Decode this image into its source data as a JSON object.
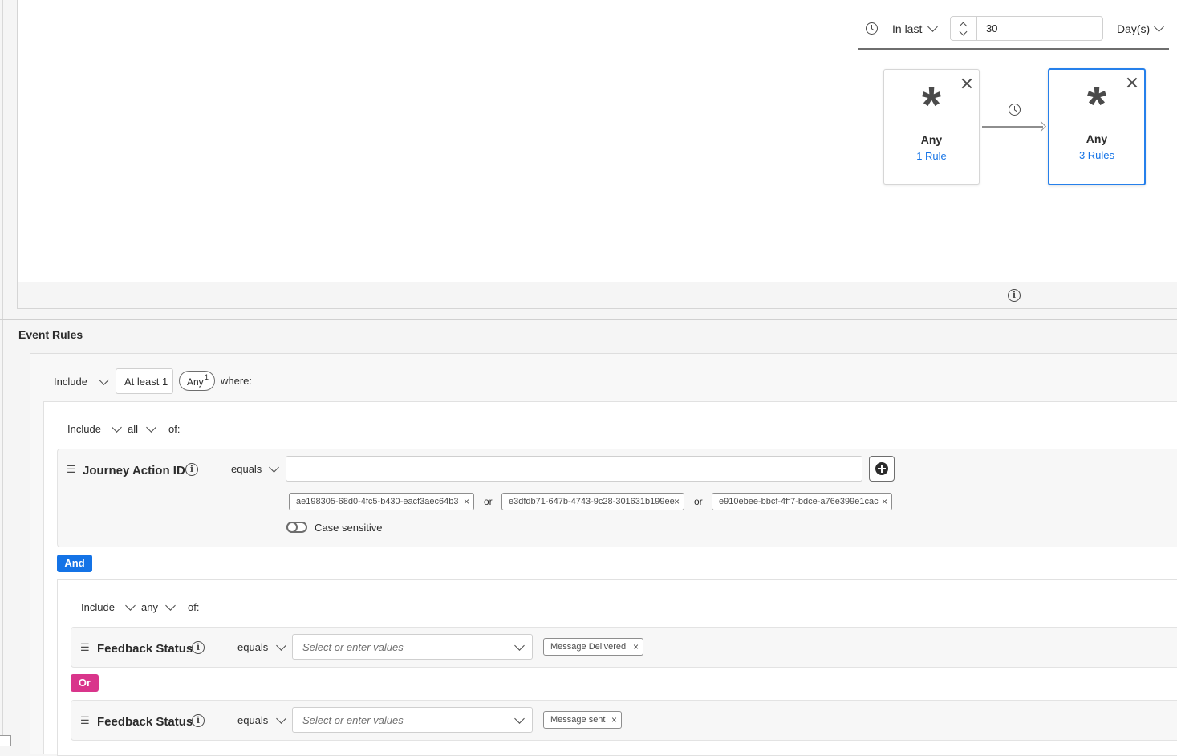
{
  "time_window": {
    "mode_label": "In last",
    "amount": "30",
    "unit_label": "Day(s)"
  },
  "sequence": {
    "steps": [
      {
        "title": "Any",
        "rules_label": "1 Rule",
        "selected": false
      },
      {
        "title": "Any",
        "rules_label": "3 Rules",
        "selected": true
      }
    ]
  },
  "event_rules": {
    "section_title": "Event Rules",
    "top": {
      "include_label": "Include",
      "count_label": "At least 1",
      "any_label": "Any",
      "any_superscript": "1",
      "where_label": "where:"
    },
    "group1": {
      "include_label": "Include",
      "quantifier": "all",
      "of_label": "of:",
      "rule": {
        "field": "Journey Action ID",
        "operator": "equals",
        "input_value": "",
        "values": [
          "ae198305-68d0-4fc5-b430-eacf3aec64b3",
          "e3dfdb71-647b-4743-9c28-301631b199ee",
          "e910ebee-bbcf-4ff7-bdce-a76e399e1cac"
        ],
        "or_label": "or",
        "case_sensitive_label": "Case sensitive"
      }
    },
    "and_label": "And",
    "group2": {
      "include_label": "Include",
      "quantifier": "any",
      "of_label": "of:",
      "or_label": "Or",
      "rules": [
        {
          "field": "Feedback Status",
          "operator": "equals",
          "placeholder": "Select or enter values",
          "value": "Message Delivered"
        },
        {
          "field": "Feedback Status",
          "operator": "equals",
          "placeholder": "Select or enter values",
          "value": "Message sent"
        }
      ]
    }
  },
  "colors": {
    "accent_blue": "#1473e6",
    "and_badge": "#1473e6",
    "or_badge": "#d9358b",
    "selected_border": "#2680eb"
  }
}
